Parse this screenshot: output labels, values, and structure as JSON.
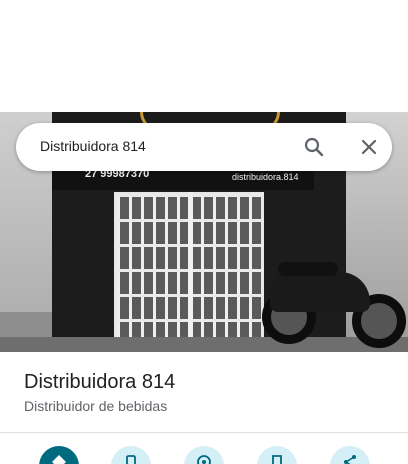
{
  "search": {
    "value": "Distribuidora 814"
  },
  "photo": {
    "sign_phone": "27 99987370",
    "sign_handle": "distribuidora.814"
  },
  "place": {
    "name": "Distribuidora 814",
    "category": "Distribuidor de bebidas"
  },
  "actions": [
    {
      "icon": "directions-icon"
    },
    {
      "icon": "phone-icon"
    },
    {
      "icon": "nearby-icon"
    },
    {
      "icon": "save-icon"
    },
    {
      "icon": "share-icon"
    }
  ],
  "colors": {
    "primary_action": "#006a80",
    "secondary_action": "#d4eff5",
    "title_text": "#202124",
    "subtitle_text": "#5f6368"
  }
}
